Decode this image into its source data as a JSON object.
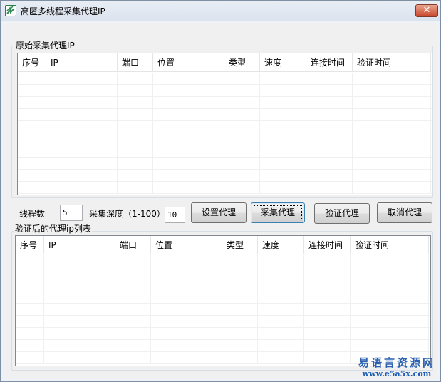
{
  "window": {
    "title": "高匿多线程采集代理IP",
    "close_label": "✕"
  },
  "group_original": {
    "label": "原始采集代理IP",
    "columns": [
      "序号",
      "IP",
      "端口",
      "位置",
      "类型",
      "速度",
      "连接时间",
      "验证时间"
    ]
  },
  "controls": {
    "threads_label": "线程数",
    "threads_value": "5",
    "depth_label": "采集深度（1-100）",
    "depth_value": "10",
    "btn_set_proxy": "设置代理",
    "btn_collect": "采集代理",
    "btn_verify": "验证代理",
    "btn_cancel": "取消代理"
  },
  "group_verified": {
    "label": "验证后的代理ip列表",
    "columns": [
      "序号",
      "IP",
      "端口",
      "位置",
      "类型",
      "速度",
      "连接时间",
      "验证时间"
    ]
  },
  "watermark": {
    "brand": "易语言资源网",
    "url": "www.e5a5x.com"
  }
}
